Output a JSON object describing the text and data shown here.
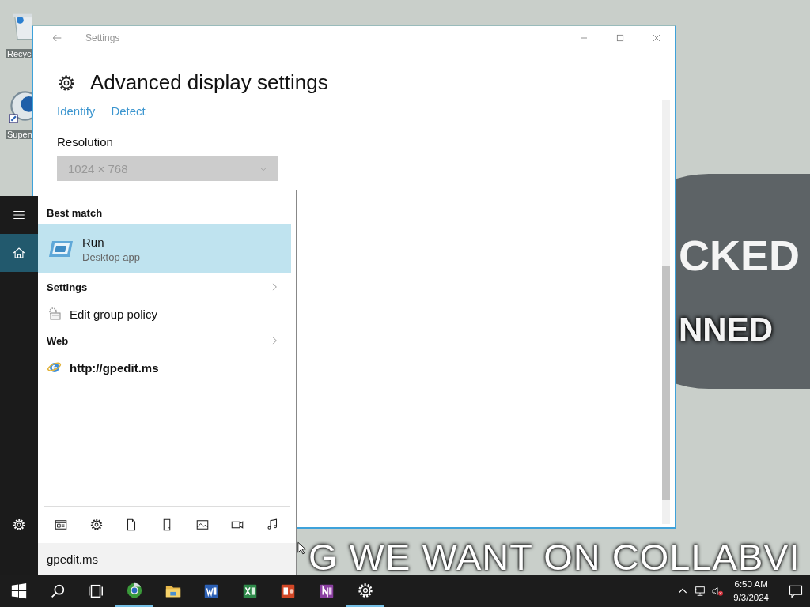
{
  "desktop": {
    "icons": [
      {
        "kind": "bin",
        "label": "Recyc"
      },
      {
        "kind": "app",
        "label": "Supen"
      }
    ],
    "wallpaper_texts": [
      "CKED",
      "NNED"
    ],
    "caption": "G WE WANT ON COLLABVI"
  },
  "settings_window": {
    "title": "Settings",
    "heading": "Advanced display settings",
    "links": [
      "Identify",
      "Detect"
    ],
    "resolution": {
      "label": "Resolution",
      "value": "1024 × 768",
      "disabled": true
    }
  },
  "search_panel": {
    "rail": [
      {
        "kind": "menu",
        "selected": false
      },
      {
        "kind": "home",
        "selected": true
      },
      {
        "kind": "settings",
        "selected": false
      }
    ],
    "sections": [
      {
        "heading": "Best match",
        "has_more": false,
        "results": [
          {
            "kind": "app",
            "title": "Run",
            "subtitle": "Desktop app",
            "selected": true
          }
        ]
      },
      {
        "heading": "Settings",
        "has_more": true,
        "results": [
          {
            "kind": "setting",
            "title": "Edit group policy",
            "selected": false
          }
        ]
      },
      {
        "heading": "Web",
        "has_more": true,
        "results": [
          {
            "kind": "web",
            "title": "http://gpedit.ms",
            "selected": false
          }
        ]
      }
    ],
    "filters": [
      {
        "kind": "apps"
      },
      {
        "kind": "settings"
      },
      {
        "kind": "documents"
      },
      {
        "kind": "folders"
      },
      {
        "kind": "photos"
      },
      {
        "kind": "videos"
      },
      {
        "kind": "music"
      }
    ],
    "query": "gpedit.ms"
  },
  "taskbar": {
    "apps": [
      {
        "kind": "browser",
        "running": true
      },
      {
        "kind": "folder",
        "running": false
      },
      {
        "kind": "document",
        "running": false
      },
      {
        "kind": "spreadsheet",
        "running": false
      },
      {
        "kind": "presentation",
        "running": false
      },
      {
        "kind": "notebook",
        "running": false
      },
      {
        "kind": "settings",
        "running": true
      }
    ],
    "volume_muted": true,
    "time": "6:50 AM",
    "date": "9/3/2024"
  }
}
